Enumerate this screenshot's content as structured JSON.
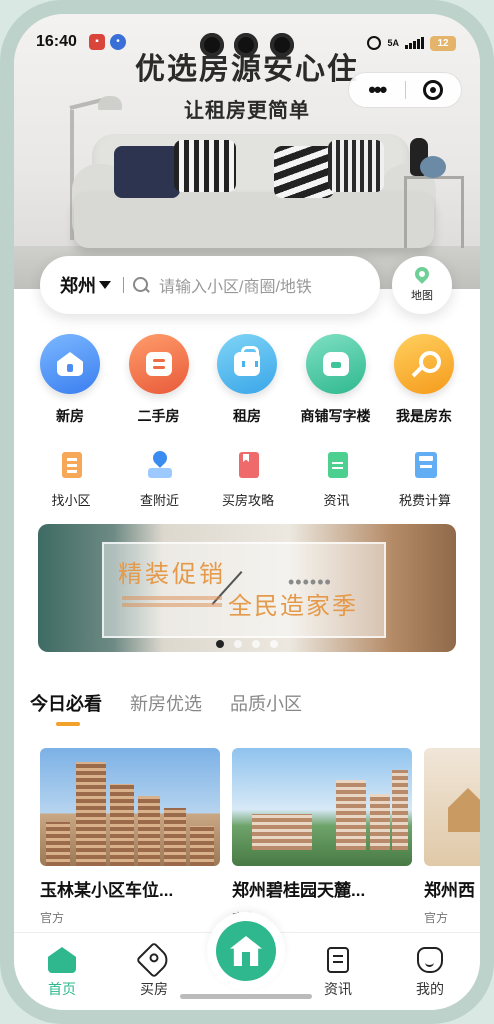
{
  "status_bar": {
    "time": "16:40",
    "network": "5A",
    "battery": "12"
  },
  "hero": {
    "title": "优选房源安心住",
    "subtitle": "让租房更简单"
  },
  "capsule": {
    "more_label": "•••"
  },
  "search": {
    "city": "郑州",
    "placeholder": "请输入小区/商圈/地铁"
  },
  "map_button": {
    "label": "地图"
  },
  "main_nav": [
    {
      "label": "新房",
      "icon": "house-icon"
    },
    {
      "label": "二手房",
      "icon": "document-icon"
    },
    {
      "label": "租房",
      "icon": "bag-icon"
    },
    {
      "label": "商铺写字楼",
      "icon": "shop-icon"
    },
    {
      "label": "我是房东",
      "icon": "key-icon"
    }
  ],
  "tools_nav": [
    {
      "label": "找小区",
      "icon": "building-icon"
    },
    {
      "label": "查附近",
      "icon": "location-icon"
    },
    {
      "label": "买房攻略",
      "icon": "book-icon"
    },
    {
      "label": "资讯",
      "icon": "news-icon"
    },
    {
      "label": "税费计算",
      "icon": "calculator-icon"
    }
  ],
  "banner": {
    "title_line1": "精装促销",
    "title_line2": "全民造家季",
    "dots_text": "••••••",
    "active_page": 1,
    "page_count": 4
  },
  "tabs": [
    {
      "label": "今日必看",
      "active": true
    },
    {
      "label": "新房优选",
      "active": false
    },
    {
      "label": "品质小区",
      "active": false
    }
  ],
  "cards": [
    {
      "title": "玉林某小区车位...",
      "source": "官方"
    },
    {
      "title": "郑州碧桂园天麓...",
      "source": "官方"
    },
    {
      "title": "郑州西",
      "source": "官方"
    }
  ],
  "tabbar": [
    {
      "label": "首页",
      "icon": "home-icon",
      "active": true
    },
    {
      "label": "买房",
      "icon": "tag-icon",
      "active": false
    },
    {
      "label": "资讯",
      "icon": "document-icon",
      "active": false
    },
    {
      "label": "我的",
      "icon": "profile-icon",
      "active": false
    }
  ],
  "colors": {
    "accent_green": "#2fb88e",
    "tab_underline": "#f2a12a"
  }
}
